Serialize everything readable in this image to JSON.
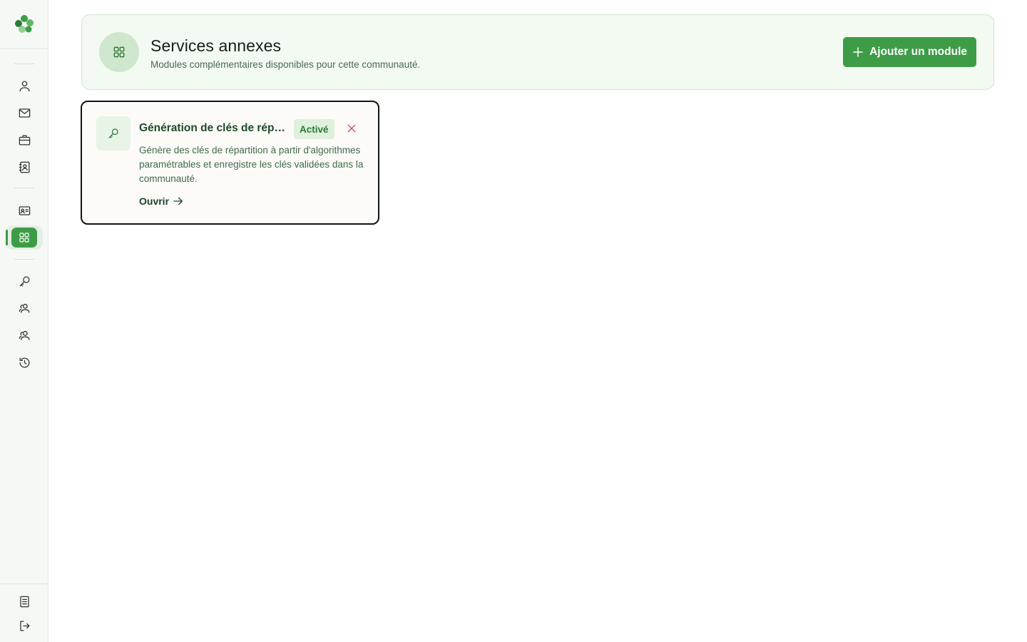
{
  "sidebar": {
    "logo": "clover-logo",
    "items": [
      {
        "id": "user",
        "icon": "user-icon"
      },
      {
        "id": "mail",
        "icon": "mail-icon"
      },
      {
        "id": "briefcase",
        "icon": "briefcase-icon"
      },
      {
        "id": "contacts",
        "icon": "contact-book-icon"
      },
      {
        "id": "id-card",
        "icon": "id-card-icon"
      },
      {
        "id": "modules",
        "icon": "grid-icon",
        "active": true
      },
      {
        "id": "key",
        "icon": "key-icon"
      },
      {
        "id": "group-1",
        "icon": "users-icon"
      },
      {
        "id": "group-2",
        "icon": "users-icon"
      },
      {
        "id": "history",
        "icon": "history-icon"
      },
      {
        "id": "docs",
        "icon": "document-icon"
      },
      {
        "id": "logout",
        "icon": "logout-icon"
      }
    ],
    "accent": "#3e9c47"
  },
  "header": {
    "title": "Services annexes",
    "subtitle": "Modules complémentaires disponibles pour cette communauté.",
    "add_button_label": "Ajouter un module",
    "icon": "grid-icon"
  },
  "modules": [
    {
      "title": "Génération de clés de répa...",
      "status": "Activé",
      "description": "Génère des clés de répartition à partir d'algorithmes paramétrables et enregistre les clés validées dans la communauté.",
      "open_label": "Ouvrir",
      "icon": "key-icon"
    }
  ],
  "colors": {
    "primary": "#3e9c47",
    "header_bg": "#f3faf2",
    "danger": "#d9343a"
  }
}
